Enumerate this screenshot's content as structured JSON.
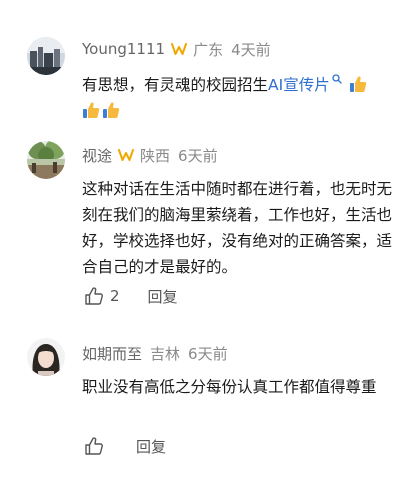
{
  "comments": [
    {
      "author": "Young1111",
      "location": "广东",
      "time": "4天前",
      "text_before": "有思想，有灵魂的校园招生",
      "link_text": "AI宣传片",
      "emoji": "thumbs-up",
      "likes": "",
      "reply_label": ""
    },
    {
      "author": "视途",
      "location": "陕西",
      "time": "6天前",
      "text": "这种对话在生活中随时都在进行着，也无时无刻在我们的脑海里萦绕着，工作也好，生活也好，学校选择也好，没有绝对的正确答案，适合自己的才是最好的。",
      "likes": "2",
      "reply_label": "回复"
    },
    {
      "author": "如期而至",
      "location": "吉林",
      "time": "6天前",
      "text": "职业没有高低之分每份认真工作都值得尊重",
      "likes": "",
      "reply_label": "回复"
    }
  ],
  "colors": {
    "author": "#666666",
    "meta": "#8a8a8a",
    "link": "#2e6fd0",
    "badge": "#f0a800",
    "text": "#1a1a1a"
  }
}
